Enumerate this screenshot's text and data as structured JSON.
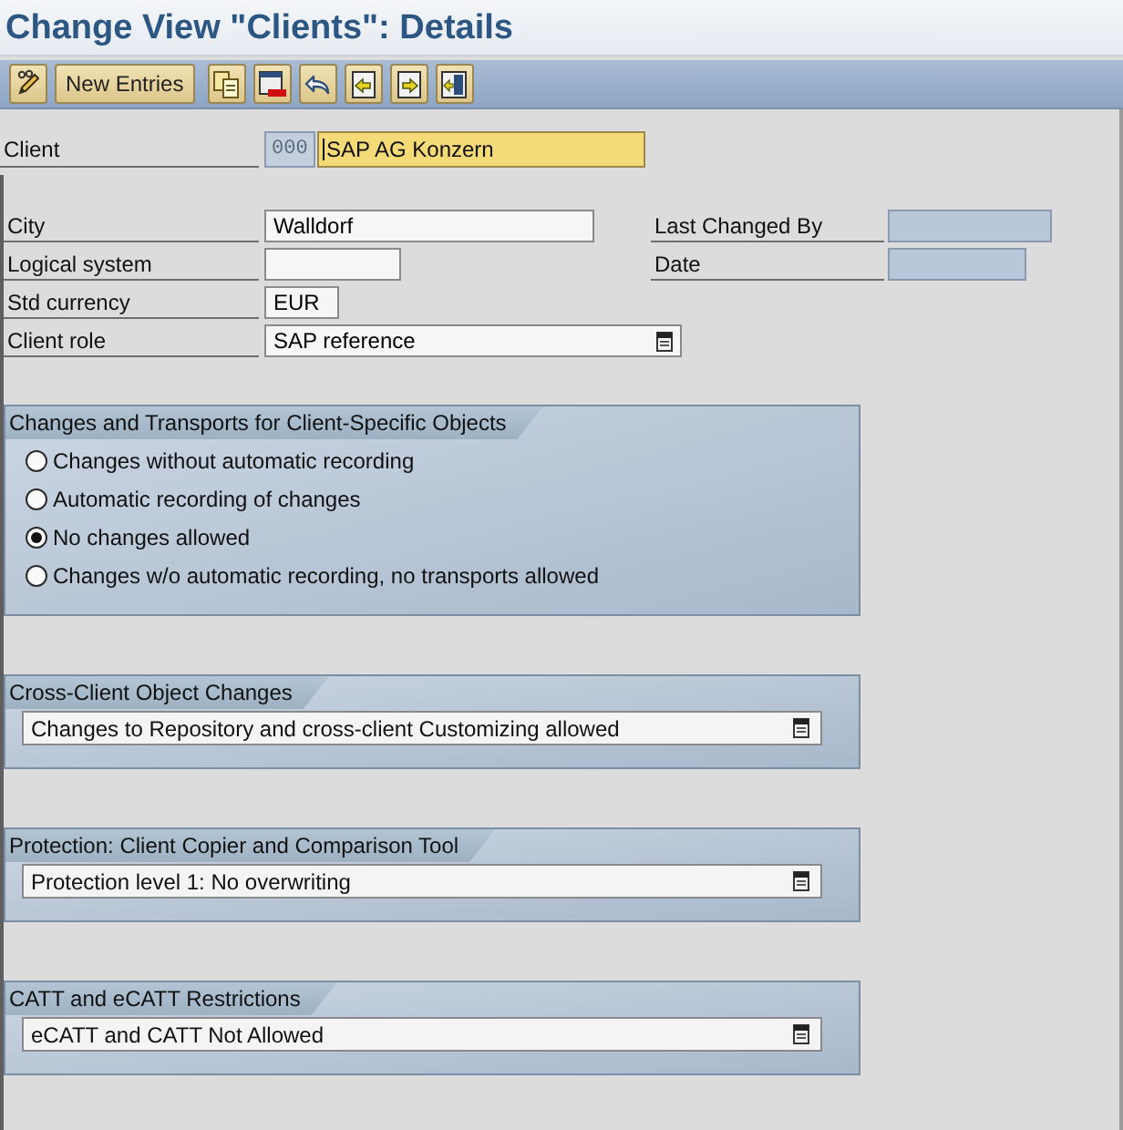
{
  "window": {
    "title": "Change View \"Clients\": Details"
  },
  "toolbar": {
    "buttons": [
      "New Entries"
    ]
  },
  "client": {
    "label": "Client",
    "number": {
      "value": "000",
      "disabled": true
    },
    "name": {
      "value": "SAP AG Konzern",
      "focused": true
    }
  },
  "fields": [
    {
      "label": "City",
      "value": "Walldorf",
      "disabled": false,
      "kind": "text"
    },
    {
      "label": "Logical system",
      "disabled": false,
      "kind": "text"
    },
    {
      "label": "Std currency",
      "value": "EUR",
      "disabled": false,
      "kind": "text"
    },
    {
      "label": "Client role",
      "value": "SAP reference",
      "disabled": false,
      "kind": "dropdown"
    }
  ],
  "side_fields": [
    {
      "label": "Last Changed By",
      "disabled": true
    },
    {
      "label": "Date",
      "disabled": true
    }
  ],
  "groups": [
    {
      "title": "Changes and Transports for Client-Specific Objects",
      "kind": "radio",
      "options": [
        {
          "label": "Changes without automatic recording",
          "selected": false
        },
        {
          "label": "Automatic recording of changes",
          "selected": false
        },
        {
          "label": "No changes allowed",
          "selected": true
        },
        {
          "label": "Changes w/o automatic recording, no transports allowed",
          "selected": false
        }
      ]
    },
    {
      "title": "Cross-Client Object Changes",
      "kind": "dropdown",
      "value": "Changes to Repository and cross-client Customizing allowed"
    },
    {
      "title": "Protection: Client Copier and Comparison Tool",
      "kind": "dropdown",
      "value": "Protection level 1: No overwriting"
    },
    {
      "title": "CATT and eCATT Restrictions",
      "kind": "dropdown",
      "value": "eCATT and CATT Not Allowed"
    }
  ]
}
